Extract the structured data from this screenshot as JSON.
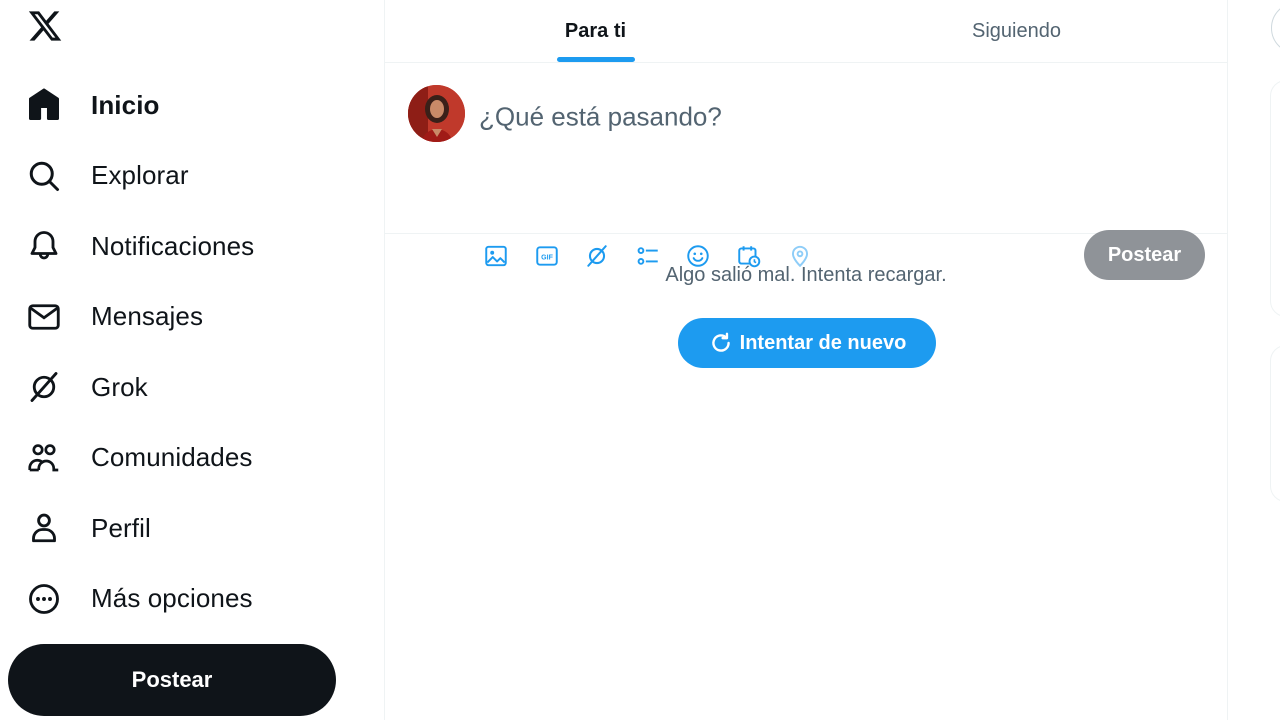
{
  "sidebar": {
    "logo_icon": "x-logo-icon",
    "items": [
      {
        "label": "Inicio",
        "icon": "home-icon",
        "active": true
      },
      {
        "label": "Explorar",
        "icon": "search-icon"
      },
      {
        "label": "Notificaciones",
        "icon": "bell-icon"
      },
      {
        "label": "Mensajes",
        "icon": "envelope-icon"
      },
      {
        "label": "Grok",
        "icon": "grok-icon"
      },
      {
        "label": "Comunidades",
        "icon": "people-icon"
      },
      {
        "label": "Perfil",
        "icon": "person-icon"
      },
      {
        "label": "Más opciones",
        "icon": "more-circle-icon"
      }
    ],
    "post_label": "Postear"
  },
  "main": {
    "tabs": [
      {
        "label": "Para ti",
        "active": true
      },
      {
        "label": "Siguiendo",
        "active": false
      }
    ],
    "composer": {
      "placeholder": "¿Qué está pasando?",
      "tools": [
        "image-icon",
        "gif-icon",
        "grok-icon",
        "poll-icon",
        "emoji-icon",
        "schedule-icon",
        "location-icon"
      ],
      "post_label": "Postear"
    },
    "error": {
      "message": "Algo salió mal. Intenta recargar.",
      "retry_label": "Intentar de nuevo"
    }
  },
  "colors": {
    "accent": "#1d9bf0",
    "text_primary": "#0f1419",
    "text_secondary": "#536471",
    "post_button": "#0f1419",
    "post_button_disabled": "#8f9398"
  }
}
